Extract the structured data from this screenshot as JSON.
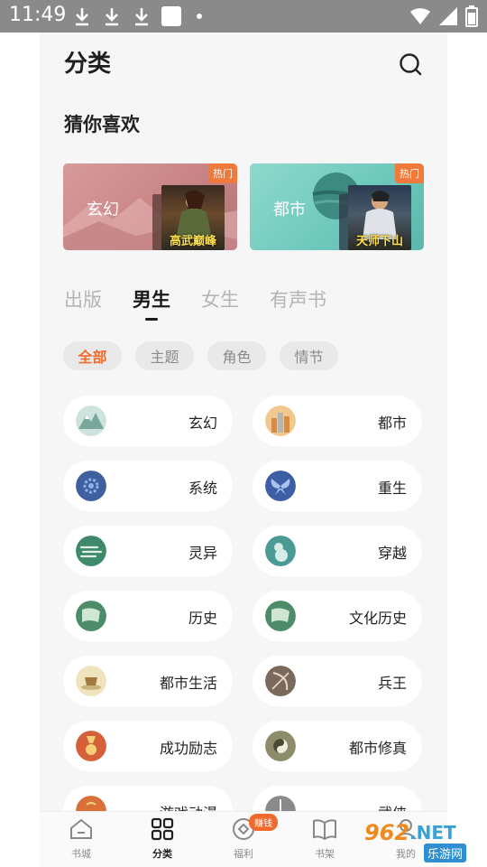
{
  "status_bar": {
    "time": "11:49"
  },
  "header": {
    "title": "分类"
  },
  "recommend": {
    "title": "猜你喜欢",
    "banners": [
      {
        "label": "玄幻",
        "badge": "热门",
        "cover_title": "高武巅峰",
        "color": "#c98586"
      },
      {
        "label": "都市",
        "badge": "热门",
        "cover_title": "天师下山",
        "color": "#6cc8ba"
      }
    ]
  },
  "tabs": [
    "出版",
    "男生",
    "女生",
    "有声书"
  ],
  "active_tab": "男生",
  "chips": [
    "全部",
    "主题",
    "角色",
    "情节"
  ],
  "active_chip": "全部",
  "categories": [
    {
      "label": "玄幻",
      "icon": "mountain-icon",
      "color": "#8bbbb0"
    },
    {
      "label": "都市",
      "icon": "city-icon",
      "color": "#e3a65e"
    },
    {
      "label": "系统",
      "icon": "gear-icon",
      "color": "#3f5fa0"
    },
    {
      "label": "重生",
      "icon": "butterfly-icon",
      "color": "#3d5da5"
    },
    {
      "label": "灵异",
      "icon": "wind-icon",
      "color": "#3f8a6a"
    },
    {
      "label": "穿越",
      "icon": "gourd-icon",
      "color": "#4a9a95"
    },
    {
      "label": "历史",
      "icon": "scroll-icon",
      "color": "#4d8c68"
    },
    {
      "label": "文化历史",
      "icon": "scroll-icon",
      "color": "#4d8c68"
    },
    {
      "label": "都市生活",
      "icon": "teacup-icon",
      "color": "#e7d9a8"
    },
    {
      "label": "兵王",
      "icon": "bow-icon",
      "color": "#7a6a5c"
    },
    {
      "label": "成功励志",
      "icon": "medal-icon",
      "color": "#d6603a"
    },
    {
      "label": "都市修真",
      "icon": "taichi-icon",
      "color": "#8c8c6a"
    },
    {
      "label": "游戏动漫",
      "icon": "game-icon",
      "color": "#d9703a"
    },
    {
      "label": "武侠",
      "icon": "sword-icon",
      "color": "#8a8a8a"
    }
  ],
  "bottom_nav": [
    {
      "label": "书城",
      "icon": "home-icon"
    },
    {
      "label": "分类",
      "icon": "category-icon"
    },
    {
      "label": "福利",
      "icon": "coin-icon"
    },
    {
      "label": "书架",
      "icon": "book-icon"
    },
    {
      "label": "我的",
      "icon": "profile-icon"
    }
  ],
  "active_nav": "分类",
  "earn_badge": "赚钱",
  "watermark": {
    "number": "962",
    "net": ".NET",
    "cn": "乐游网"
  }
}
